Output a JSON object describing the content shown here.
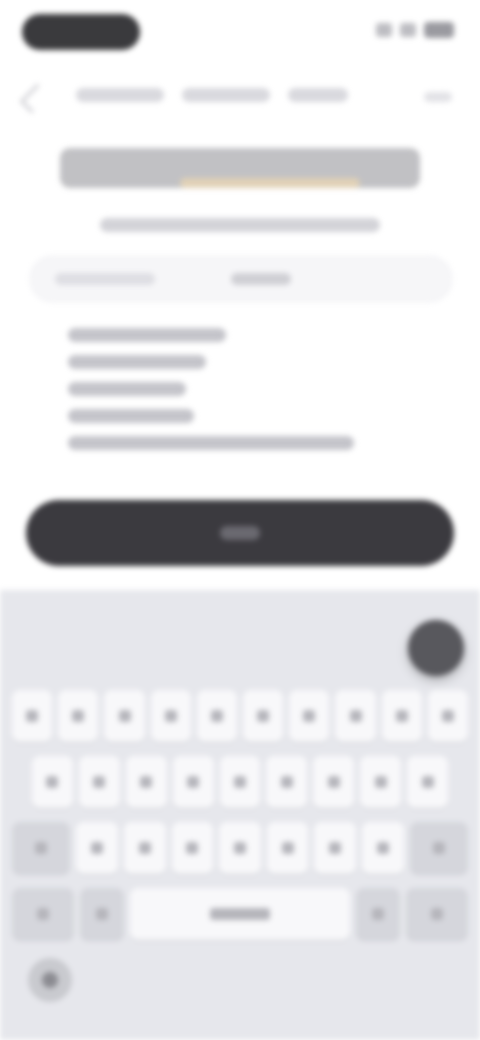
{
  "colors": {
    "primary_button": "#3b3a3f",
    "keyboard_bg": "#e6e7ec",
    "key_bg": "#f8f8fa",
    "fab": "#58585d"
  },
  "icons": {
    "back": "back-chevron-icon",
    "more": "more-icon",
    "fab": "floating-action-icon",
    "globe": "globe-icon"
  },
  "keyboard": {
    "rows": [
      10,
      9,
      9,
      5
    ]
  }
}
